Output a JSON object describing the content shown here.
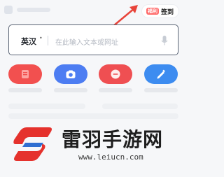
{
  "header": {
    "signin_badge": "福利",
    "signin_label": "签到"
  },
  "search": {
    "language": "英汉",
    "placeholder": "在此输入文本或网址"
  },
  "features": [
    {
      "icon": "document-scan-icon",
      "color": "#f2504f"
    },
    {
      "icon": "camera-icon",
      "color": "#4d7df2"
    },
    {
      "icon": "voice-translate-icon",
      "color": "#ef4f52"
    },
    {
      "icon": "edit-icon",
      "color": "#3d8cf0"
    }
  ],
  "watermark": {
    "name": "雷羽手游网",
    "url": "www.leiucn.com"
  },
  "colors": {
    "arrow": "#e8443a",
    "accent_red": "#f2504f",
    "accent_blue": "#4d7df2"
  }
}
